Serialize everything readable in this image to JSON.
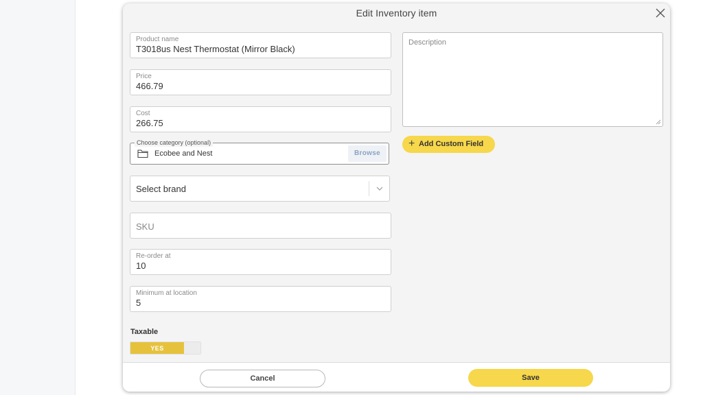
{
  "modal": {
    "title": "Edit Inventory item"
  },
  "form": {
    "product_name": {
      "label": "Product name",
      "value": "T3018us Nest Thermostat (Mirror Black)"
    },
    "price": {
      "label": "Price",
      "value": "466.79"
    },
    "cost": {
      "label": "Cost",
      "value": "266.75"
    },
    "category": {
      "label": "Choose category (optional)",
      "value": "Ecobee and Nest",
      "browse_label": "Browse"
    },
    "brand": {
      "value": "Select brand"
    },
    "sku": {
      "placeholder": "SKU"
    },
    "reorder_at": {
      "label": "Re-order at",
      "value": "10"
    },
    "minimum_at_location": {
      "label": "Minimum at location",
      "value": "5"
    },
    "description": {
      "placeholder": "Description"
    },
    "add_custom_field_label": "Add Custom Field",
    "taxable": {
      "label": "Taxable",
      "value": "YES"
    }
  },
  "footer": {
    "cancel_label": "Cancel",
    "save_label": "Save"
  },
  "icons": {
    "close": "close-icon",
    "folder": "folder-icon",
    "chevron": "chevron-down-icon",
    "plus": "plus-icon"
  },
  "colors": {
    "accent": "#f7d74b",
    "toggle_on": "#e6c23c",
    "browse_text": "#8aa3c2"
  }
}
